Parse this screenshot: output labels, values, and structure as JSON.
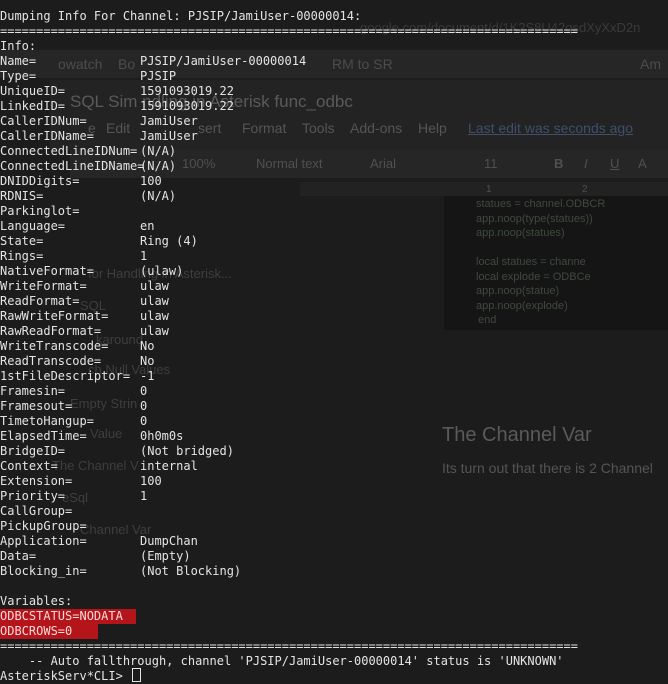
{
  "background": {
    "url_fragment": "google.com/document/d/1K2S8U42qsdXyXxD2n",
    "bookmarks": [
      "owatch",
      "Bo",
      "RM to SR",
      "Am"
    ],
    "doc_title": "SQL Sim          ndling in Asterisk func_odbc",
    "menus": [
      "e",
      "Edit",
      "sert",
      "Format",
      "Tools",
      "Add-ons",
      "Help"
    ],
    "last_edit": "Last edit was seconds ago",
    "toolbar": {
      "zoom": "100%",
      "style": "Normal text",
      "font": "Arial",
      "size": "11",
      "bold": "B",
      "italic": "I",
      "underline": "U",
      "color": "A"
    },
    "ruler_marks": [
      "1",
      "2"
    ],
    "code_lines": [
      "statues = channel.ODBCR",
      "app.noop(type(statues))",
      "app.noop(statues)",
      "",
      "local statues = channe",
      "local explode = ODBCe",
      "app.noop(statue)",
      "app.noop(explode)",
      "end"
    ],
    "outline": [
      "for Handling in Asterisk...",
      "SQL",
      "karound",
      "ch Null Values",
      "Empty Strin",
      "Value",
      "The Channel V",
      "eSql",
      "Channel Var"
    ],
    "heading": "The Channel Var",
    "paragraph": "Its turn out that there is 2 Channel"
  },
  "terminal": {
    "header": "Dumping Info For Channel: PJSIP/JamiUser-00000014:",
    "separator": "================================================================================",
    "info_label": "Info:",
    "fields": [
      {
        "key": "Name=",
        "value": "PJSIP/JamiUser-00000014"
      },
      {
        "key": "Type=",
        "value": "PJSIP"
      },
      {
        "key": "UniqueID=",
        "value": "1591093019.22"
      },
      {
        "key": "LinkedID=",
        "value": "1591093019.22"
      },
      {
        "key": "CallerIDNum=",
        "value": "JamiUser"
      },
      {
        "key": "CallerIDName=",
        "value": "JamiUser"
      },
      {
        "key": "ConnectedLineIDNum=",
        "value": "(N/A)"
      },
      {
        "key": "ConnectedLineIDName=",
        "value": "(N/A)"
      },
      {
        "key": "DNIDDigits=",
        "value": "100"
      },
      {
        "key": "RDNIS=",
        "value": "(N/A)"
      },
      {
        "key": "Parkinglot=",
        "value": ""
      },
      {
        "key": "Language=",
        "value": "en"
      },
      {
        "key": "State=",
        "value": "Ring (4)"
      },
      {
        "key": "Rings=",
        "value": "1"
      },
      {
        "key": "NativeFormat=",
        "value": "(ulaw)"
      },
      {
        "key": "WriteFormat=",
        "value": "ulaw"
      },
      {
        "key": "ReadFormat=",
        "value": "ulaw"
      },
      {
        "key": "RawWriteFormat=",
        "value": "ulaw"
      },
      {
        "key": "RawReadFormat=",
        "value": "ulaw"
      },
      {
        "key": "WriteTranscode=",
        "value": "No"
      },
      {
        "key": "ReadTranscode=",
        "value": "No"
      },
      {
        "key": "1stFileDescriptor=",
        "value": "-1"
      },
      {
        "key": "Framesin=",
        "value": "0"
      },
      {
        "key": "Framesout=",
        "value": "0"
      },
      {
        "key": "TimetoHangup=",
        "value": "0"
      },
      {
        "key": "ElapsedTime=",
        "value": "0h0m0s"
      },
      {
        "key": "BridgeID=",
        "value": "(Not bridged)"
      },
      {
        "key": "Context=",
        "value": "internal"
      },
      {
        "key": "Extension=",
        "value": "100"
      },
      {
        "key": "Priority=",
        "value": "1"
      },
      {
        "key": "CallGroup=",
        "value": ""
      },
      {
        "key": "PickupGroup=",
        "value": ""
      },
      {
        "key": "Application=",
        "value": "DumpChan"
      },
      {
        "key": "Data=",
        "value": "(Empty)"
      },
      {
        "key": "Blocking_in=",
        "value": "(Not Blocking)"
      }
    ],
    "variables_label": "Variables:",
    "variables": [
      "ODBCSTATUS=NODATA",
      "ODBCROWS=0"
    ],
    "fallthrough": "    -- Auto fallthrough, channel 'PJSIP/JamiUser-00000014' status is 'UNKNOWN'",
    "prompt": "AsteriskServ*CLI> ",
    "colors": {
      "text": "#e4e4e4",
      "background": "#1c1c1c",
      "highlight": "#b3151a"
    }
  }
}
